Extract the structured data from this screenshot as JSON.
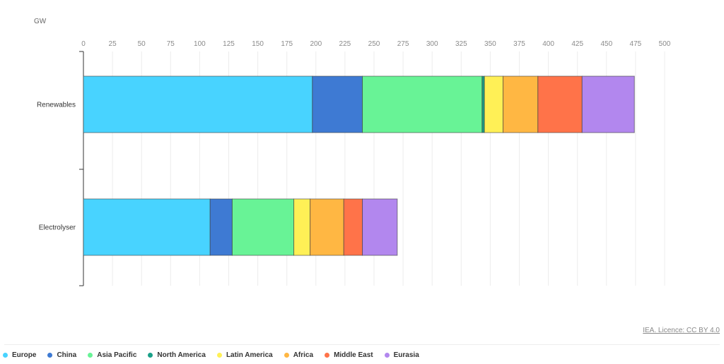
{
  "chart_data": {
    "type": "bar",
    "orientation": "horizontal",
    "stacked": true,
    "unit_label": "GW",
    "xlim": [
      0,
      500
    ],
    "x_ticks": [
      0,
      25,
      50,
      75,
      100,
      125,
      150,
      175,
      200,
      225,
      250,
      275,
      300,
      325,
      350,
      375,
      400,
      425,
      450,
      475,
      500
    ],
    "grid": true,
    "categories": [
      "Renewables",
      "Electrolyser"
    ],
    "series": [
      {
        "name": "Europe",
        "color": "#48d3ff",
        "values": [
          197,
          109
        ]
      },
      {
        "name": "China",
        "color": "#3e7ad3",
        "values": [
          43,
          19
        ]
      },
      {
        "name": "Asia Pacific",
        "color": "#68f396",
        "values": [
          103,
          53
        ]
      },
      {
        "name": "North America",
        "color": "#1aa088",
        "values": [
          2,
          0
        ]
      },
      {
        "name": "Latin America",
        "color": "#fff056",
        "values": [
          16,
          14
        ]
      },
      {
        "name": "Africa",
        "color": "#ffb743",
        "values": [
          30,
          29
        ]
      },
      {
        "name": "Middle East",
        "color": "#ff7349",
        "values": [
          38,
          16
        ]
      },
      {
        "name": "Eurasia",
        "color": "#b287ee",
        "values": [
          45,
          30
        ]
      }
    ],
    "legend_position": "bottom-left"
  },
  "credit": "IEA. Licence: CC BY 4.0"
}
